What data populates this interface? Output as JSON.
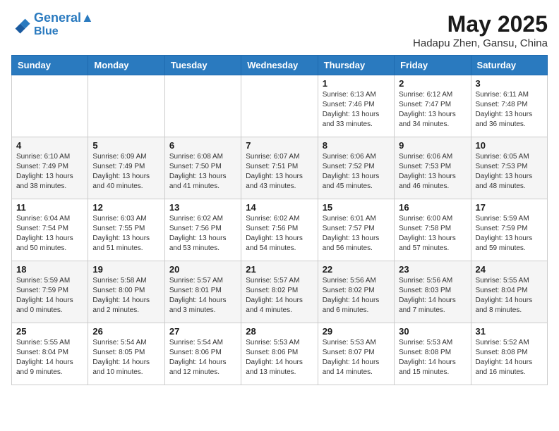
{
  "header": {
    "logo_line1": "General",
    "logo_line2": "Blue",
    "month": "May 2025",
    "location": "Hadapu Zhen, Gansu, China"
  },
  "days_of_week": [
    "Sunday",
    "Monday",
    "Tuesday",
    "Wednesday",
    "Thursday",
    "Friday",
    "Saturday"
  ],
  "weeks": [
    [
      {
        "day": "",
        "info": ""
      },
      {
        "day": "",
        "info": ""
      },
      {
        "day": "",
        "info": ""
      },
      {
        "day": "",
        "info": ""
      },
      {
        "day": "1",
        "info": "Sunrise: 6:13 AM\nSunset: 7:46 PM\nDaylight: 13 hours\nand 33 minutes."
      },
      {
        "day": "2",
        "info": "Sunrise: 6:12 AM\nSunset: 7:47 PM\nDaylight: 13 hours\nand 34 minutes."
      },
      {
        "day": "3",
        "info": "Sunrise: 6:11 AM\nSunset: 7:48 PM\nDaylight: 13 hours\nand 36 minutes."
      }
    ],
    [
      {
        "day": "4",
        "info": "Sunrise: 6:10 AM\nSunset: 7:49 PM\nDaylight: 13 hours\nand 38 minutes."
      },
      {
        "day": "5",
        "info": "Sunrise: 6:09 AM\nSunset: 7:49 PM\nDaylight: 13 hours\nand 40 minutes."
      },
      {
        "day": "6",
        "info": "Sunrise: 6:08 AM\nSunset: 7:50 PM\nDaylight: 13 hours\nand 41 minutes."
      },
      {
        "day": "7",
        "info": "Sunrise: 6:07 AM\nSunset: 7:51 PM\nDaylight: 13 hours\nand 43 minutes."
      },
      {
        "day": "8",
        "info": "Sunrise: 6:06 AM\nSunset: 7:52 PM\nDaylight: 13 hours\nand 45 minutes."
      },
      {
        "day": "9",
        "info": "Sunrise: 6:06 AM\nSunset: 7:53 PM\nDaylight: 13 hours\nand 46 minutes."
      },
      {
        "day": "10",
        "info": "Sunrise: 6:05 AM\nSunset: 7:53 PM\nDaylight: 13 hours\nand 48 minutes."
      }
    ],
    [
      {
        "day": "11",
        "info": "Sunrise: 6:04 AM\nSunset: 7:54 PM\nDaylight: 13 hours\nand 50 minutes."
      },
      {
        "day": "12",
        "info": "Sunrise: 6:03 AM\nSunset: 7:55 PM\nDaylight: 13 hours\nand 51 minutes."
      },
      {
        "day": "13",
        "info": "Sunrise: 6:02 AM\nSunset: 7:56 PM\nDaylight: 13 hours\nand 53 minutes."
      },
      {
        "day": "14",
        "info": "Sunrise: 6:02 AM\nSunset: 7:56 PM\nDaylight: 13 hours\nand 54 minutes."
      },
      {
        "day": "15",
        "info": "Sunrise: 6:01 AM\nSunset: 7:57 PM\nDaylight: 13 hours\nand 56 minutes."
      },
      {
        "day": "16",
        "info": "Sunrise: 6:00 AM\nSunset: 7:58 PM\nDaylight: 13 hours\nand 57 minutes."
      },
      {
        "day": "17",
        "info": "Sunrise: 5:59 AM\nSunset: 7:59 PM\nDaylight: 13 hours\nand 59 minutes."
      }
    ],
    [
      {
        "day": "18",
        "info": "Sunrise: 5:59 AM\nSunset: 7:59 PM\nDaylight: 14 hours\nand 0 minutes."
      },
      {
        "day": "19",
        "info": "Sunrise: 5:58 AM\nSunset: 8:00 PM\nDaylight: 14 hours\nand 2 minutes."
      },
      {
        "day": "20",
        "info": "Sunrise: 5:57 AM\nSunset: 8:01 PM\nDaylight: 14 hours\nand 3 minutes."
      },
      {
        "day": "21",
        "info": "Sunrise: 5:57 AM\nSunset: 8:02 PM\nDaylight: 14 hours\nand 4 minutes."
      },
      {
        "day": "22",
        "info": "Sunrise: 5:56 AM\nSunset: 8:02 PM\nDaylight: 14 hours\nand 6 minutes."
      },
      {
        "day": "23",
        "info": "Sunrise: 5:56 AM\nSunset: 8:03 PM\nDaylight: 14 hours\nand 7 minutes."
      },
      {
        "day": "24",
        "info": "Sunrise: 5:55 AM\nSunset: 8:04 PM\nDaylight: 14 hours\nand 8 minutes."
      }
    ],
    [
      {
        "day": "25",
        "info": "Sunrise: 5:55 AM\nSunset: 8:04 PM\nDaylight: 14 hours\nand 9 minutes."
      },
      {
        "day": "26",
        "info": "Sunrise: 5:54 AM\nSunset: 8:05 PM\nDaylight: 14 hours\nand 10 minutes."
      },
      {
        "day": "27",
        "info": "Sunrise: 5:54 AM\nSunset: 8:06 PM\nDaylight: 14 hours\nand 12 minutes."
      },
      {
        "day": "28",
        "info": "Sunrise: 5:53 AM\nSunset: 8:06 PM\nDaylight: 14 hours\nand 13 minutes."
      },
      {
        "day": "29",
        "info": "Sunrise: 5:53 AM\nSunset: 8:07 PM\nDaylight: 14 hours\nand 14 minutes."
      },
      {
        "day": "30",
        "info": "Sunrise: 5:53 AM\nSunset: 8:08 PM\nDaylight: 14 hours\nand 15 minutes."
      },
      {
        "day": "31",
        "info": "Sunrise: 5:52 AM\nSunset: 8:08 PM\nDaylight: 14 hours\nand 16 minutes."
      }
    ]
  ]
}
